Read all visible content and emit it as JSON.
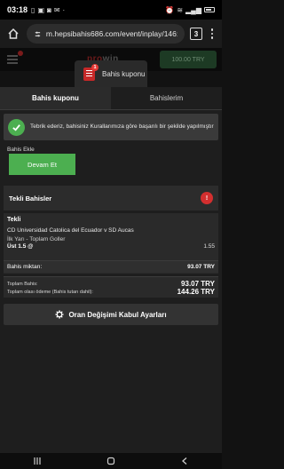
{
  "status_bar": {
    "time": "03:18",
    "icons": [
      "sim-icon",
      "photo-icon",
      "chat-icon",
      "message-icon",
      "dots-icon"
    ],
    "right_icons": [
      "alarm-icon",
      "wifi-icon",
      "signal-icon",
      "battery-icon"
    ]
  },
  "browser": {
    "url": "m.hepsibahis686.com/event/inplay/146:",
    "tab_count": "3"
  },
  "site_header": {
    "logo_primary": "pro",
    "logo_secondary": "win",
    "balance": "100.00 TRY"
  },
  "coupon": {
    "tab_label": "Bahis kuponu",
    "count": "1"
  },
  "tabs": [
    {
      "label": "Bahis kuponu",
      "active": true
    },
    {
      "label": "Bahislerim",
      "active": false
    }
  ],
  "success_message": "Tebrik ederiz, bahisiniz Kurallarımıza göre başarılı bir şekilde yapılmıştır",
  "add_bet": {
    "label": "Bahis Ekle",
    "continue_button": "Devam Et"
  },
  "singles": {
    "title": "Tekli Bahisler",
    "badge": "!"
  },
  "bet": {
    "type": "Tekli",
    "event": "CD Universidad Catolica del Ecuador v SD Aucas",
    "market": "İlk Yarı - Toplam Goller",
    "selection": "Üst 1.5 @",
    "odds": "1.55"
  },
  "stake": {
    "label": "Bahis miktarı:",
    "value": "93.07 TRY"
  },
  "totals": {
    "total_stake_label": "Toplam Bahis:",
    "total_stake_value": "93.07 TRY",
    "potential_payout_label": "Toplam olası ödeme (Bahis tutarı dahil):",
    "potential_payout_value": "144.26 TRY"
  },
  "odds_settings_button": "Oran Değişimi Kabul Ayarları",
  "colors": {
    "accent_green": "#4caf50",
    "badge_red": "#d32f2f",
    "panel_bg": "#1e1e1e"
  }
}
